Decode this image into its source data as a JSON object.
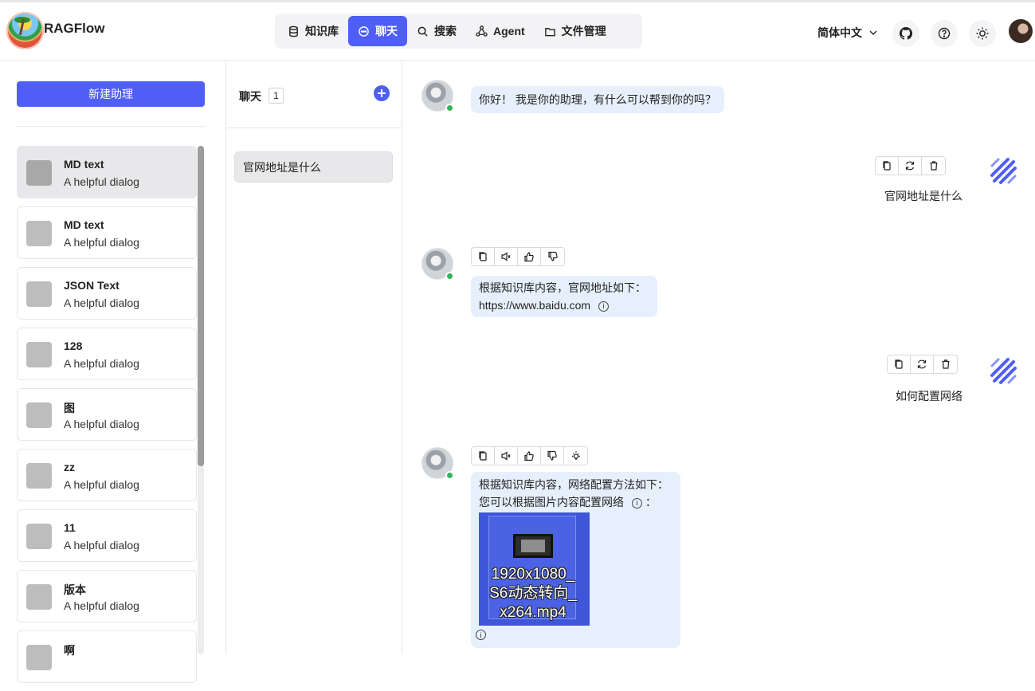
{
  "app": {
    "brand": "RAGFlow"
  },
  "nav": {
    "items": [
      {
        "label": "知识库",
        "icon": "database-icon"
      },
      {
        "label": "聊天",
        "icon": "chat-bubble-icon",
        "active": true
      },
      {
        "label": "搜索",
        "icon": "search-icon"
      },
      {
        "label": "Agent",
        "icon": "agent-graph-icon"
      },
      {
        "label": "文件管理",
        "icon": "folder-icon"
      }
    ]
  },
  "header": {
    "language": "简体中文"
  },
  "sidebar": {
    "new_button": "新建助理",
    "assistants": [
      {
        "name": "MD text",
        "desc": "A helpful dialog"
      },
      {
        "name": "MD text",
        "desc": "A helpful dialog"
      },
      {
        "name": "JSON Text",
        "desc": "A helpful dialog"
      },
      {
        "name": "128",
        "desc": "A helpful dialog"
      },
      {
        "name": "图",
        "desc": "A helpful dialog"
      },
      {
        "name": "zz",
        "desc": "A helpful dialog"
      },
      {
        "name": "11",
        "desc": "A helpful dialog"
      },
      {
        "name": "版本",
        "desc": "A helpful dialog"
      },
      {
        "name": "啊",
        "desc": ""
      }
    ]
  },
  "conversations": {
    "title": "聊天",
    "count": "1",
    "items": [
      {
        "label": "官网地址是什么"
      }
    ]
  },
  "chat": {
    "greeting": "你好！ 我是你的助理，有什么可以帮到你的吗？",
    "q1": "官网地址是什么",
    "a1_line1": "根据知识库内容，官网地址如下：",
    "a1_line2": "https://www.baidu.com",
    "q2": "如何配置网络",
    "a2_line1": "根据知识库内容，网络配置方法如下：",
    "a2_line2": "您可以根据图片内容配置网络",
    "a2_line2_suffix": "：",
    "video_name": "1920x1080_S6动态转向_x264.mp4"
  },
  "colors": {
    "accent": "#4f5ef5",
    "bubble": "#e6f0fc",
    "online": "#34b35a"
  }
}
